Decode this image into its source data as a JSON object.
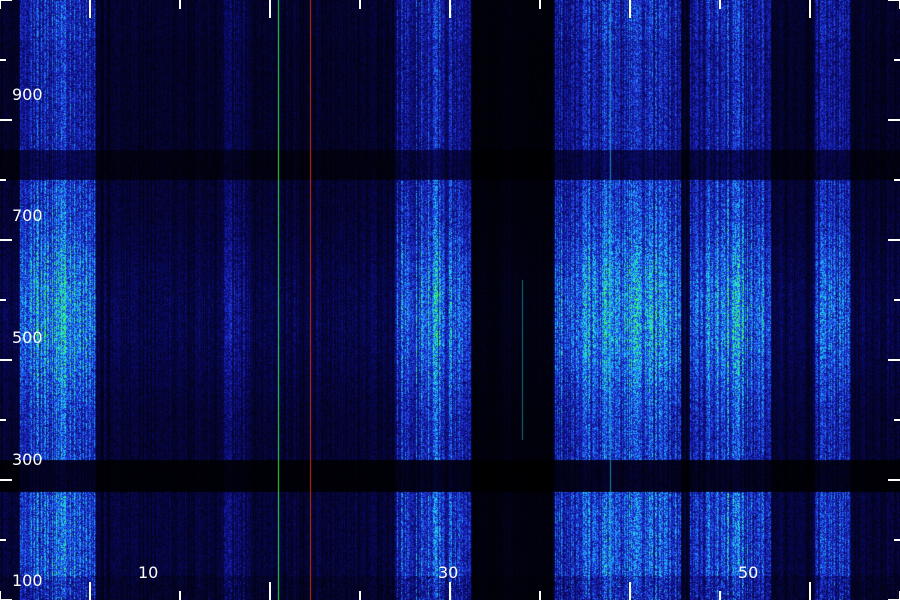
{
  "chart_data": {
    "type": "heatmap",
    "title": "",
    "xlabel": "",
    "ylabel": "",
    "xlim": [
      5,
      55
    ],
    "ylim": [
      100,
      1100
    ],
    "x_tick_labels": [
      "10",
      "30",
      "50"
    ],
    "y_tick_labels": [
      "900",
      "700",
      "500",
      "300",
      "100"
    ],
    "colormap": [
      "#000000",
      "#0a0a6e",
      "#1f2fd8",
      "#1f8cff",
      "#22e0e6",
      "#3cff46",
      "#ff3a1e"
    ],
    "line_color": "#ffffff"
  }
}
